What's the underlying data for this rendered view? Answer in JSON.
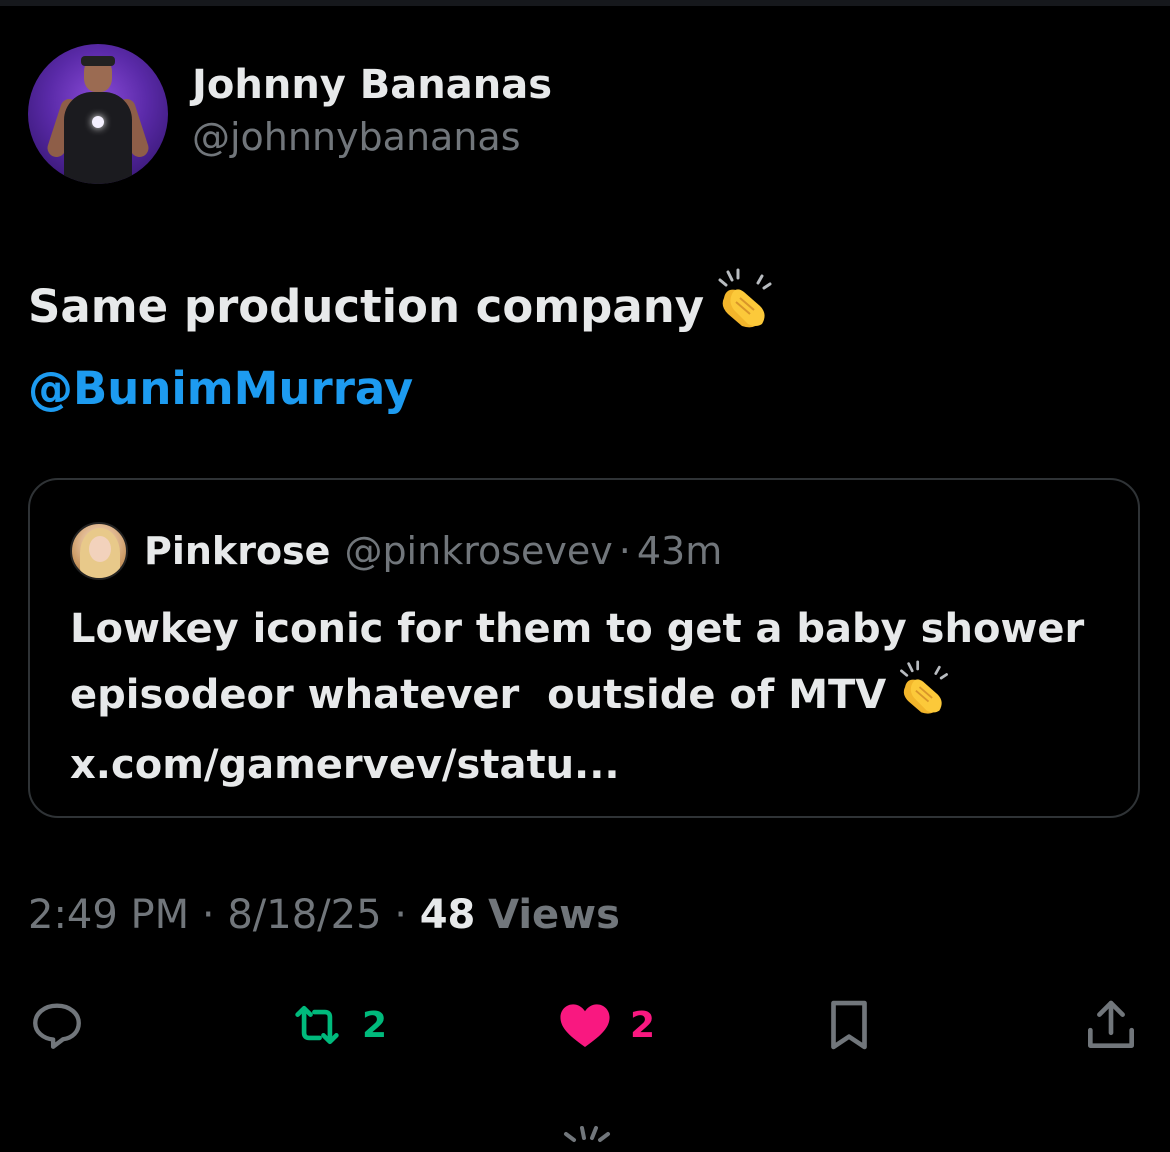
{
  "author": {
    "display_name": "Johnny Bananas",
    "handle": "@johnnybananas"
  },
  "tweet": {
    "text": "Same production company",
    "emoji": "clapping-hands",
    "mention": "@BunimMurray"
  },
  "quoted_tweet": {
    "display_name": "Pinkrose",
    "handle": "@pinkrosevev",
    "separator": "·",
    "time": "43m",
    "line1": "Lowkey iconic for them to get a baby shower",
    "line2": "episodeor whatever  outside of MTV",
    "emoji": "clapping-hands",
    "line3": "x.com/gamervev/statu..."
  },
  "meta": {
    "time": "2:49 PM",
    "sep1": "·",
    "date": "8/18/25",
    "sep2": "·",
    "views_count": "48",
    "views_label": "Views"
  },
  "actions": {
    "reply_icon": "reply-icon",
    "retweet_icon": "retweet-icon",
    "retweet_count": "2",
    "like_icon": "heart-icon",
    "like_count": "2",
    "bookmark_icon": "bookmark-icon",
    "share_icon": "share-icon"
  },
  "colors": {
    "background": "#000000",
    "text": "#e7e9ea",
    "muted": "#71767b",
    "link": "#1d9bf0",
    "retweet": "#00ba7c",
    "like": "#f91880",
    "border": "#2f3336"
  }
}
